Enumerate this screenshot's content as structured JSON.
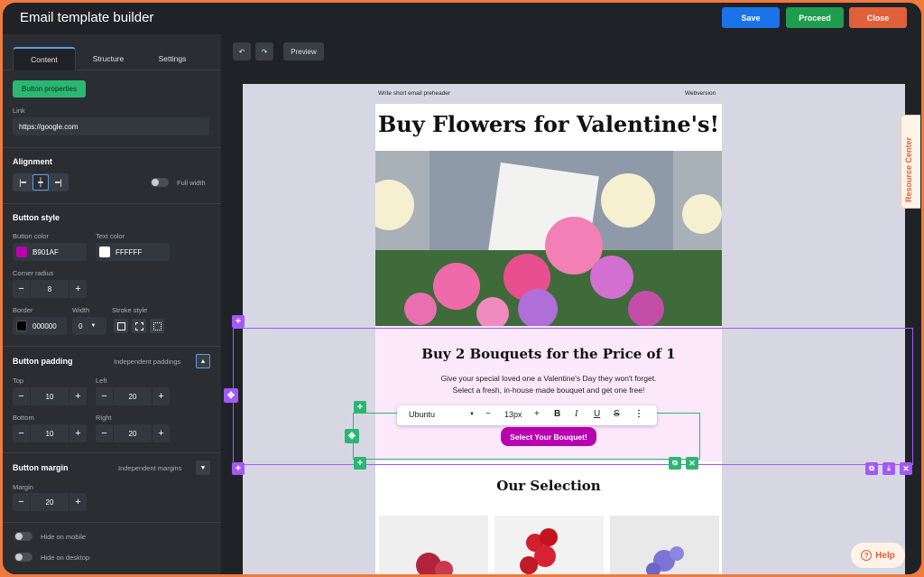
{
  "app": {
    "title": "Email template builder"
  },
  "topbar": {
    "save": "Save",
    "proceed": "Proceed",
    "close": "Close"
  },
  "sidebar": {
    "tabs": [
      "Content",
      "Structure",
      "Settings"
    ],
    "button_properties": "Button properties",
    "link_label": "Link",
    "link_value": "https://google.com",
    "alignment_title": "Alignment",
    "full_width": "Full width",
    "button_style_title": "Button style",
    "button_color_label": "Button color",
    "button_color_value": "B901AF",
    "text_color_label": "Text color",
    "text_color_value": "FFFFFF",
    "corner_radius_label": "Corner radius",
    "corner_radius_value": "8",
    "border_label": "Border",
    "border_color_value": "000000",
    "width_label": "Width",
    "width_value": "0",
    "stroke_label": "Stroke style",
    "padding_title": "Button padding",
    "independent_paddings": "Independent paddings",
    "top_label": "Top",
    "top_value": "10",
    "left_label": "Left",
    "left_value": "20",
    "bottom_label": "Bottom",
    "bottom_value": "10",
    "right_label": "Right",
    "right_value": "20",
    "margin_title": "Button margin",
    "independent_margins": "Independent margins",
    "margin_label": "Margin",
    "margin_value": "20",
    "hide_mobile": "Hide on mobile",
    "hide_desktop": "Hide on desktop"
  },
  "canvas": {
    "preview": "Preview"
  },
  "email": {
    "preheader": "Write short email preheader",
    "webversion": "Webversion",
    "title": "Buy Flowers for Valentine's!",
    "h2": "Buy 2 Bouquets for the Price of 1",
    "p": "Give your special loved one a Valentine's Day they won't forget. Select a fresh, in-house made bouquet and get one free!",
    "cta": "Select Your Bouquet!",
    "selection": "Our Selection"
  },
  "text_toolbar": {
    "font": "Ubuntu",
    "size": "13px"
  },
  "floating": {
    "resource_center": "Resource Center",
    "help": "Help"
  },
  "colors": {
    "accent_purple": "#a259f7",
    "button_color": "#B901AF",
    "save": "#1a73e8",
    "proceed": "#1f9d4c",
    "close": "#e0603a"
  }
}
